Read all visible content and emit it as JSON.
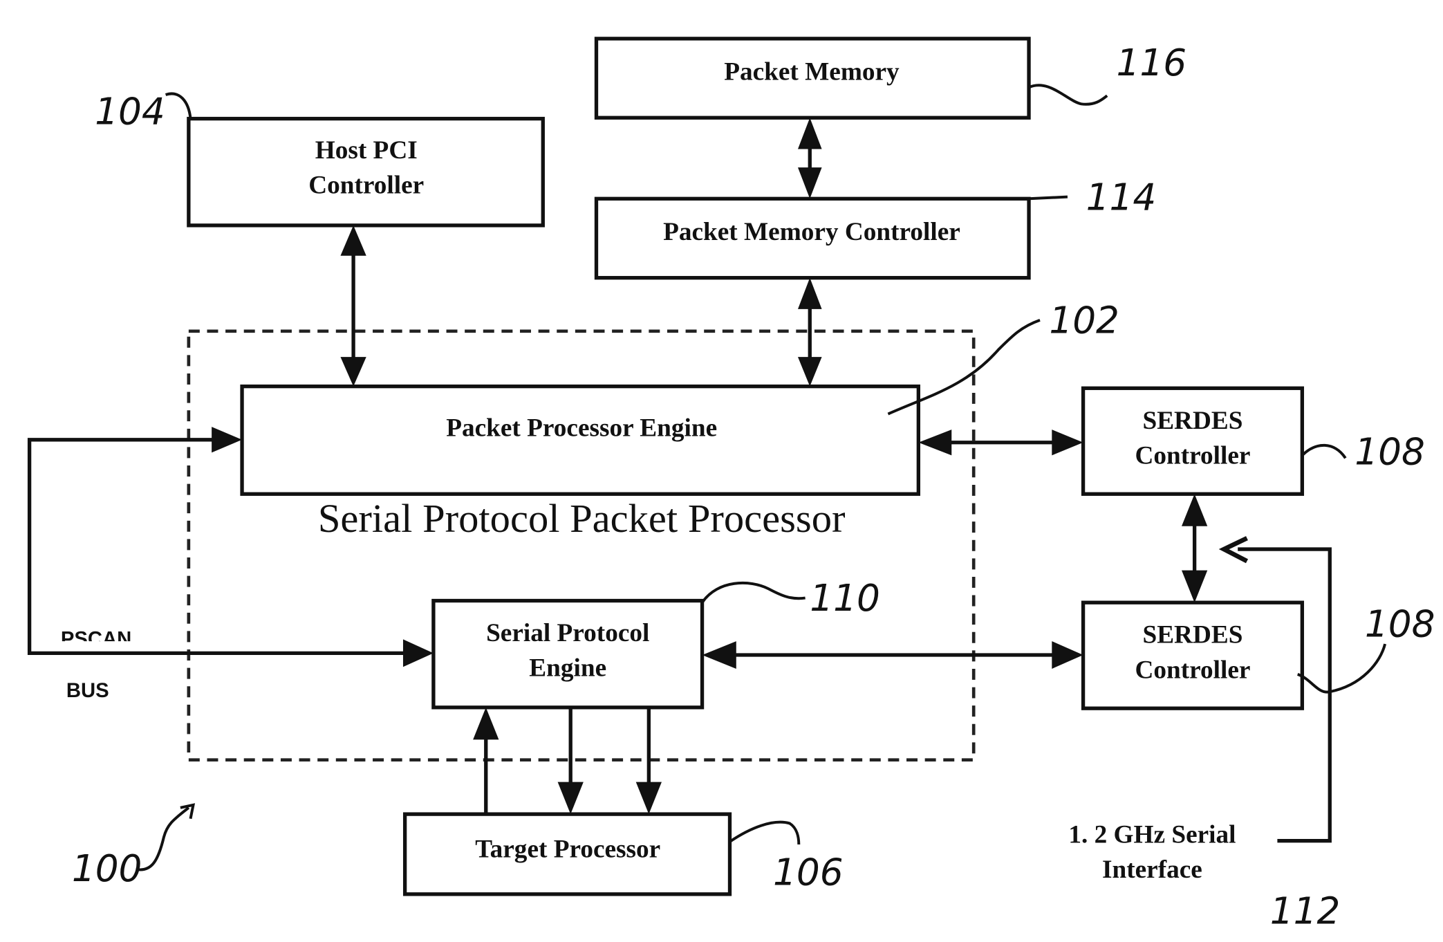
{
  "figure": {
    "system_ref": "100",
    "container": {
      "title": "Serial Protocol Packet Processor",
      "ref": "102"
    },
    "blocks": {
      "host_pci": {
        "line1": "Host PCI",
        "line2": "Controller",
        "ref": "104"
      },
      "packet_memory": {
        "label": "Packet Memory",
        "ref": "116"
      },
      "packet_memory_controller": {
        "label": "Packet Memory  Controller",
        "ref": "114"
      },
      "packet_processor_engine": {
        "label": "Packet Processor Engine"
      },
      "serial_protocol_engine": {
        "line1": "Serial Protocol",
        "line2": "Engine",
        "ref": "110"
      },
      "target_processor": {
        "label": "Target Processor",
        "ref": "106"
      },
      "serdes_top": {
        "line1": "SERDES",
        "line2": "Controller",
        "ref": "108"
      },
      "serdes_bottom": {
        "line1": "SERDES",
        "line2": "Controller",
        "ref": "108"
      }
    },
    "bus": {
      "line1": "PSCAN",
      "line2": "BUS"
    },
    "serial_interface": {
      "line1": "1. 2 GHz Serial",
      "line2": "Interface",
      "ref": "112"
    }
  }
}
